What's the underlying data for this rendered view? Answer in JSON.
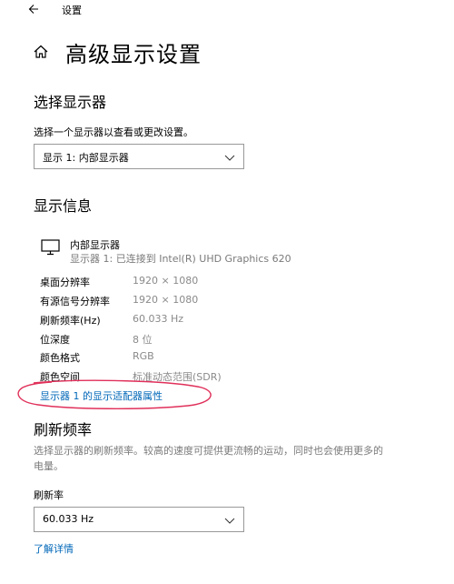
{
  "window": {
    "back_icon": "arrow-left-icon",
    "app_title": "设置"
  },
  "page": {
    "home_icon": "home-icon",
    "title": "高级显示设置"
  },
  "select_display": {
    "heading": "选择显示器",
    "caption": "选择一个显示器以查看或更改设置。",
    "selected": "显示 1: 内部显示器"
  },
  "display_info": {
    "heading": "显示信息",
    "monitor_icon": "monitor-icon",
    "monitor_name": "内部显示器",
    "monitor_connection": "显示器 1: 已连接到 Intel(R) UHD Graphics 620",
    "rows": [
      {
        "label": "桌面分辨率",
        "value": "1920 × 1080"
      },
      {
        "label": "有源信号分辨率",
        "value": "1920 × 1080"
      },
      {
        "label": "刷新频率(Hz)",
        "value": "60.033 Hz"
      },
      {
        "label": "位深度",
        "value": "8 位"
      },
      {
        "label": "颜色格式",
        "value": "RGB"
      },
      {
        "label": "颜色空间",
        "value": "标准动态范围(SDR)"
      }
    ],
    "adapter_link": "显示器 1 的显示适配器属性"
  },
  "refresh": {
    "heading": "刷新频率",
    "description": "选择显示器的刷新频率。较高的速度可提供更流畅的运动，同时也会使用更多的电量。",
    "field_label": "刷新率",
    "selected": "60.033 Hz",
    "learn_more": "了解详情"
  },
  "colors": {
    "accent_link": "#0067b8",
    "annotation": "#e0305a",
    "secondary_text": "#7a7a7a"
  }
}
